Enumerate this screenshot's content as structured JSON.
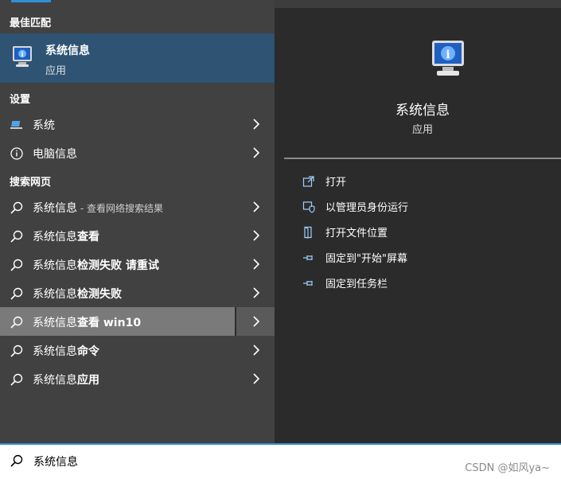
{
  "sections": {
    "best_match": "最佳匹配",
    "settings": "设置",
    "web": "搜索网页"
  },
  "best_match_item": {
    "title": "系统信息",
    "subtitle": "应用"
  },
  "settings_items": [
    {
      "label": "系统",
      "icon": "laptop-icon"
    },
    {
      "label": "电脑信息",
      "icon": "info-icon"
    }
  ],
  "web_items": [
    {
      "label": "系统信息",
      "hint": " - 查看网络搜索结果"
    },
    {
      "prefix": "系统信息",
      "bold": "查看"
    },
    {
      "prefix": "系统信息",
      "bold": "检测失败 请重试"
    },
    {
      "prefix": "系统信息",
      "bold": "检测失败"
    },
    {
      "prefix": "系统信息",
      "bold": "查看 win10"
    },
    {
      "prefix": "系统信息",
      "bold": "命令"
    },
    {
      "prefix": "系统信息",
      "bold": "应用"
    }
  ],
  "detail": {
    "title": "系统信息",
    "subtitle": "应用",
    "actions": [
      {
        "label": "打开",
        "icon": "open-icon"
      },
      {
        "label": "以管理员身份运行",
        "icon": "shield-icon"
      },
      {
        "label": "打开文件位置",
        "icon": "folder-icon"
      },
      {
        "label": "固定到\"开始\"屏幕",
        "icon": "pin-icon"
      },
      {
        "label": "固定到任务栏",
        "icon": "pin-icon"
      }
    ]
  },
  "search": {
    "value": "系统信息"
  },
  "watermark": "CSDN @如风ya~",
  "colors": {
    "accent": "#2f8fd8",
    "selected": "#2e5373",
    "hover": "#7a7a7a"
  }
}
